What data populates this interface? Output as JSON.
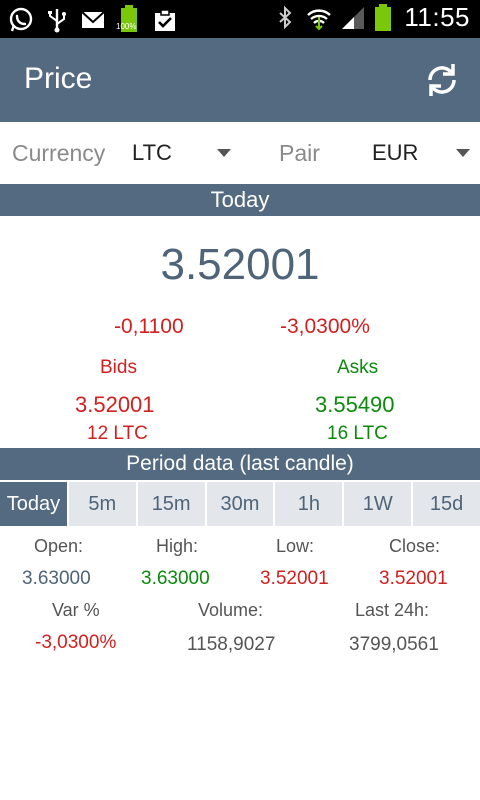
{
  "status_bar": {
    "time": "11:55",
    "battery_percent": "100%",
    "left_icons": [
      "whatsapp-icon",
      "usb-icon",
      "email-icon",
      "battery-full-icon",
      "clipboard-check-icon"
    ],
    "right_icons": [
      "bluetooth-icon",
      "wifi-icon",
      "signal-icon",
      "battery-icon"
    ]
  },
  "app_bar": {
    "title": "Price",
    "refresh_icon": "refresh-icon"
  },
  "selectors": {
    "currency_label": "Currency",
    "currency_value": "LTC",
    "pair_label": "Pair",
    "pair_value": "EUR"
  },
  "today": {
    "header": "Today",
    "price": "3.52001",
    "change_abs": "-0,1100",
    "change_pct": "-3,0300%",
    "bids_label": "Bids",
    "bids_value": "3.52001",
    "bids_amount": "12 LTC",
    "asks_label": "Asks",
    "asks_value": "3.55490",
    "asks_amount": "16 LTC"
  },
  "period": {
    "header": "Period data (last candle)",
    "tabs": [
      "Today",
      "5m",
      "15m",
      "30m",
      "1h",
      "1W",
      "15d"
    ],
    "active_tab": "Today",
    "open_label": "Open:",
    "open_value": "3.63000",
    "high_label": "High:",
    "high_value": "3.63000",
    "low_label": "Low:",
    "low_value": "3.52001",
    "close_label": "Close:",
    "close_value": "3.52001",
    "var_label": "Var %",
    "var_value": "-3,0300%",
    "volume_label": "Volume:",
    "volume_value": "1158,9027",
    "last24_label": "Last 24h:",
    "last24_value": "3799,0561"
  },
  "colors": {
    "primary": "#536a80",
    "negative": "#d02020",
    "positive": "#0d8a0d",
    "battery": "#7ac70c"
  }
}
